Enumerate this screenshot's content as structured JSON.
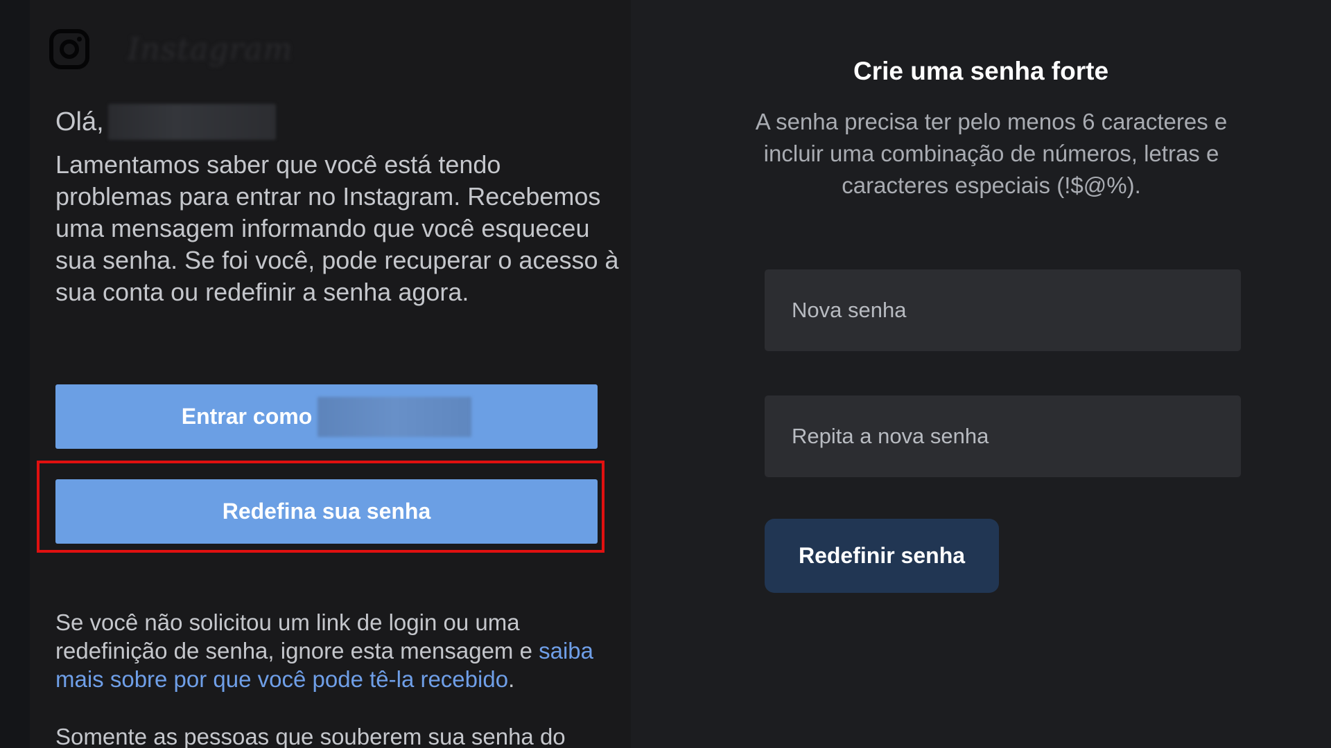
{
  "email": {
    "brand": "Instagram",
    "greeting": "Olá,",
    "message": "Lamentamos saber que você está tendo problemas para entrar no Instagram. Recebemos uma mensagem informando que você esqueceu sua senha. Se foi você, pode recuperar o acesso à sua conta ou redefinir a senha agora.",
    "login_button_label": "Entrar como",
    "reset_button_label": "Redefina sua senha",
    "disclaimer": "Se você não solicitou um link de login ou uma redefinição de senha, ignore esta mensagem e",
    "learn_more_link": "saiba mais sobre por que você pode tê-la recebido",
    "disclaimer_end": ".",
    "footer": "Somente as pessoas que souberem sua senha do"
  },
  "reset": {
    "title": "Crie uma senha forte",
    "description": "A senha precisa ter pelo menos 6 caracteres e incluir uma combinação de números, letras e caracteres especiais (!$@%).",
    "new_password_placeholder": "Nova senha",
    "repeat_password_placeholder": "Repita a nova senha",
    "submit_label": "Redefinir senha"
  },
  "colors": {
    "primary_button": "#6b9fe4",
    "submit_button": "#213653",
    "highlight": "#e01010",
    "link": "#6f9fe8"
  }
}
